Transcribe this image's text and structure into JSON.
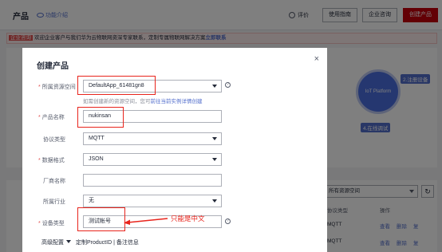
{
  "topbar": {
    "title": "产品",
    "func_intro": "功能介绍",
    "review": "评价",
    "guide": "使用指南",
    "consult": "企业咨询",
    "create": "创建产品"
  },
  "notice": {
    "tag": "企业咨询",
    "text": "欢迎企业客户与我们华为云物联网资深专家联系，定制专属物联网解决方案",
    "link": "立即联系"
  },
  "diagram": {
    "center": "IoT Platform",
    "step2": "2.注册设备",
    "step4": "4.在线调试"
  },
  "list": {
    "space_select": "所有资源空间",
    "col_protocol": "协议类型",
    "col_ops": "操作",
    "rows": [
      {
        "protocol": "MQTT",
        "view": "查看",
        "del": "删除",
        "copy": "复"
      },
      {
        "protocol": "MQTT",
        "view": "查看",
        "del": "删除",
        "copy": "复"
      }
    ]
  },
  "modal": {
    "title": "创建产品",
    "close": "×",
    "fields": {
      "resource_space": {
        "label": "所属资源空间",
        "value": "DefaultApp_61481gn8",
        "required": true
      },
      "product_name": {
        "label": "产品名称",
        "value": "nukinsan",
        "required": true
      },
      "protocol": {
        "label": "协议类型",
        "value": "MQTT",
        "required": false
      },
      "data_format": {
        "label": "数据格式",
        "value": "JSON",
        "required": true
      },
      "manufacturer": {
        "label": "厂商名称",
        "value": "",
        "required": false
      },
      "industry": {
        "label": "所属行业",
        "value": "无",
        "required": false
      },
      "device_type": {
        "label": "设备类型",
        "value": "测试帐号",
        "required": true
      }
    },
    "hint_prefix": "如需创建新的资源空间，您可",
    "hint_link": "前往当前实例详情创建",
    "advanced": "高级配置",
    "advanced_desc": "定制ProductID | 备注信息"
  },
  "annotation": {
    "text": "只能是中文",
    "color": "#e8241c"
  },
  "colors": {
    "brand_red": "#c7000b",
    "link_blue": "#526ecc",
    "required_red": "#e34d4d"
  }
}
